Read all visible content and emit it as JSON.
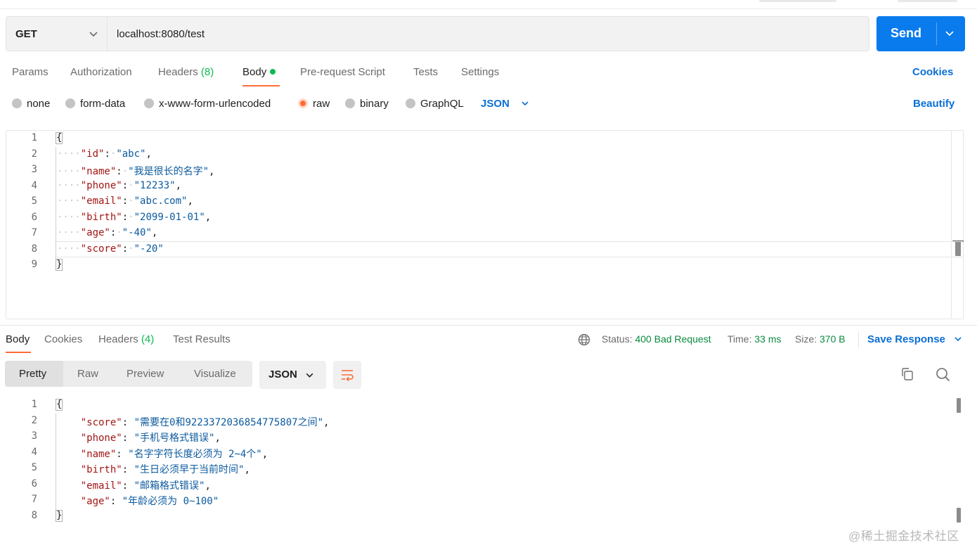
{
  "request": {
    "method": "GET",
    "url": "localhost:8080/test",
    "send_label": "Send"
  },
  "request_tabs": {
    "params": "Params",
    "authorization": "Authorization",
    "headers": "Headers",
    "headers_count": "(8)",
    "body": "Body",
    "prerequest": "Pre-request Script",
    "tests": "Tests",
    "settings": "Settings",
    "cookies": "Cookies"
  },
  "body_types": {
    "none": "none",
    "form_data": "form-data",
    "urlencoded": "x-www-form-urlencoded",
    "raw": "raw",
    "binary": "binary",
    "graphql": "GraphQL",
    "format": "JSON",
    "selected": "raw",
    "beautify": "Beautify"
  },
  "request_body": {
    "line_numbers": [
      "1",
      "2",
      "3",
      "4",
      "5",
      "6",
      "7",
      "8",
      "9"
    ],
    "open_brace": "{",
    "close_brace": "}",
    "fields": [
      {
        "key": "\"id\"",
        "value": "\"abc\"",
        "sep": ","
      },
      {
        "key": "\"name\"",
        "value": "\"我是很长的名字\"",
        "sep": ","
      },
      {
        "key": "\"phone\"",
        "value": "\"12233\"",
        "sep": ","
      },
      {
        "key": "\"email\"",
        "value": "\"abc.com\"",
        "sep": ","
      },
      {
        "key": "\"birth\"",
        "value": "\"2099-01-01\"",
        "sep": ","
      },
      {
        "key": "\"age\"",
        "value": "\"-40\"",
        "sep": ","
      },
      {
        "key": "\"score\"",
        "value": "\"-20\"",
        "sep": ""
      }
    ]
  },
  "response_tabs": {
    "body": "Body",
    "cookies": "Cookies",
    "headers": "Headers",
    "headers_count": "(4)",
    "test_results": "Test Results"
  },
  "response_meta": {
    "status_label": "Status:",
    "status_value": "400 Bad Request",
    "time_label": "Time:",
    "time_value": "33 ms",
    "size_label": "Size:",
    "size_value": "370 B",
    "save_response": "Save Response"
  },
  "view_modes": {
    "pretty": "Pretty",
    "raw": "Raw",
    "preview": "Preview",
    "visualize": "Visualize",
    "selected": "Pretty",
    "format": "JSON"
  },
  "response_body": {
    "line_numbers": [
      "1",
      "2",
      "3",
      "4",
      "5",
      "6",
      "7",
      "8"
    ],
    "open_brace": "{",
    "close_brace": "}",
    "fields": [
      {
        "key": "\"score\"",
        "value": "\"需要在0和9223372036854775807之间\"",
        "sep": ","
      },
      {
        "key": "\"phone\"",
        "value": "\"手机号格式错误\"",
        "sep": ","
      },
      {
        "key": "\"name\"",
        "value": "\"名字字符长度必须为 2~4个\"",
        "sep": ","
      },
      {
        "key": "\"birth\"",
        "value": "\"生日必须早于当前时间\"",
        "sep": ","
      },
      {
        "key": "\"email\"",
        "value": "\"邮箱格式错误\"",
        "sep": ","
      },
      {
        "key": "\"age\"",
        "value": "\"年龄必须为 0~100\"",
        "sep": ""
      }
    ]
  },
  "watermark": "@稀土掘金技术社区",
  "colors": {
    "accent": "#ff6c37",
    "send_blue": "#097bed",
    "link_blue": "#0b6fd6",
    "success_green": "#0cbb52",
    "json_key": "#a31515",
    "json_string": "#0b5a9e"
  },
  "icons": [
    "chevron-down-icon",
    "globe-icon",
    "wrap-lines-icon",
    "copy-icon",
    "search-icon"
  ]
}
